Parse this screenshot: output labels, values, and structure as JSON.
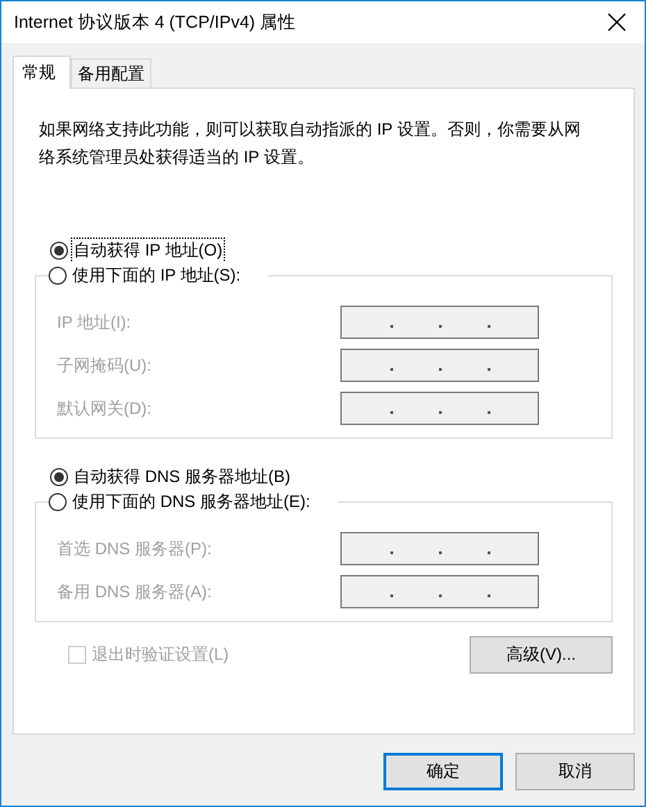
{
  "window": {
    "title": "Internet 协议版本 4 (TCP/IPv4) 属性"
  },
  "tabs": [
    {
      "label": "常规",
      "selected": true
    },
    {
      "label": "备用配置",
      "selected": false
    }
  ],
  "description": "如果网络支持此功能，则可以获取自动指派的 IP 设置。否则，你需要从网络系统管理员处获得适当的 IP 设置。",
  "ip_options": [
    {
      "label": "自动获得 IP 地址(O)",
      "selected": true,
      "focused": true
    },
    {
      "label": "使用下面的 IP 地址(S):",
      "selected": false,
      "focused": false
    }
  ],
  "ip_fields": [
    {
      "label": "IP 地址(I):",
      "disabled": true
    },
    {
      "label": "子网掩码(U):",
      "disabled": true
    },
    {
      "label": "默认网关(D):",
      "disabled": true
    }
  ],
  "dns_options": [
    {
      "label": "自动获得 DNS 服务器地址(B)",
      "selected": true,
      "focused": false
    },
    {
      "label": "使用下面的 DNS 服务器地址(E):",
      "selected": false,
      "focused": false
    }
  ],
  "dns_fields": [
    {
      "label": "首选 DNS 服务器(P):",
      "disabled": true
    },
    {
      "label": "备用 DNS 服务器(A):",
      "disabled": true
    }
  ],
  "validate": {
    "label": "退出时验证设置(L)",
    "checked": false,
    "disabled": true
  },
  "advanced_button": "高级(V)...",
  "buttons": [
    {
      "label": "确定",
      "default": true
    },
    {
      "label": "取消",
      "default": false
    }
  ]
}
